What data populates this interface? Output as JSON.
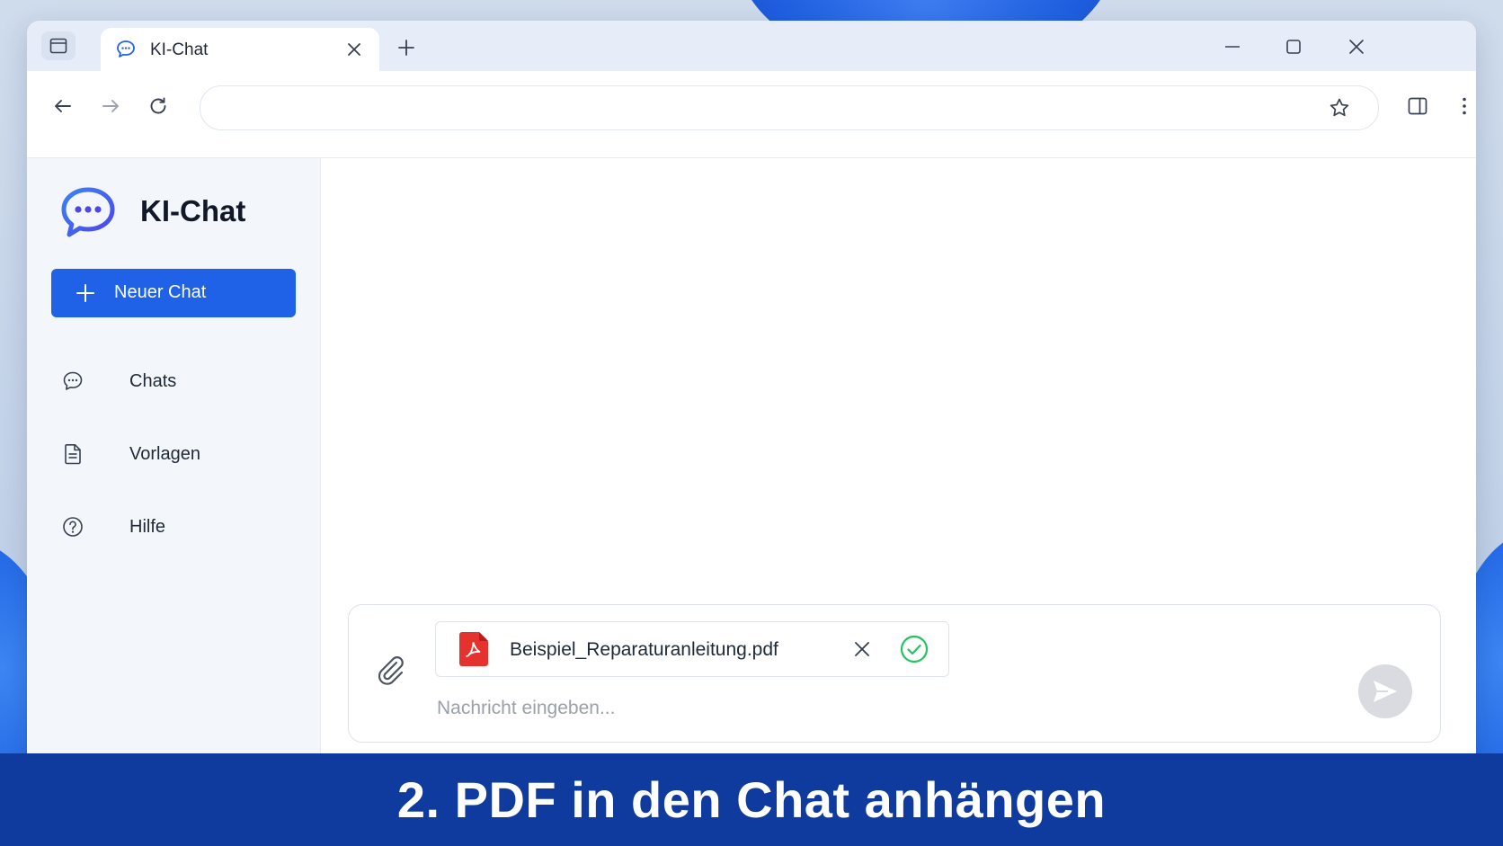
{
  "browser": {
    "tab_title": "KI-Chat",
    "address_value": ""
  },
  "sidebar": {
    "brand_name": "KI-Chat",
    "new_chat_label": "Neuer Chat",
    "items": [
      {
        "label": "Chats",
        "icon": "chat-bubble-icon"
      },
      {
        "label": "Vorlagen",
        "icon": "document-icon"
      },
      {
        "label": "Hilfe",
        "icon": "help-circle-icon"
      }
    ]
  },
  "composer": {
    "attachment": {
      "file_name": "Beispiel_Reparaturanleitung.pdf",
      "icon": "pdf-file-icon",
      "status_icon": "check-circle-icon"
    },
    "placeholder": "Nachricht eingeben...",
    "value": ""
  },
  "caption": "2. PDF in den Chat anhängen",
  "colors": {
    "primary": "#1f62e8",
    "caption_bg": "#0f3a9e",
    "pdf_red": "#e5322d",
    "success_green": "#22c55e",
    "send_disabled": "#d9dbe0"
  }
}
